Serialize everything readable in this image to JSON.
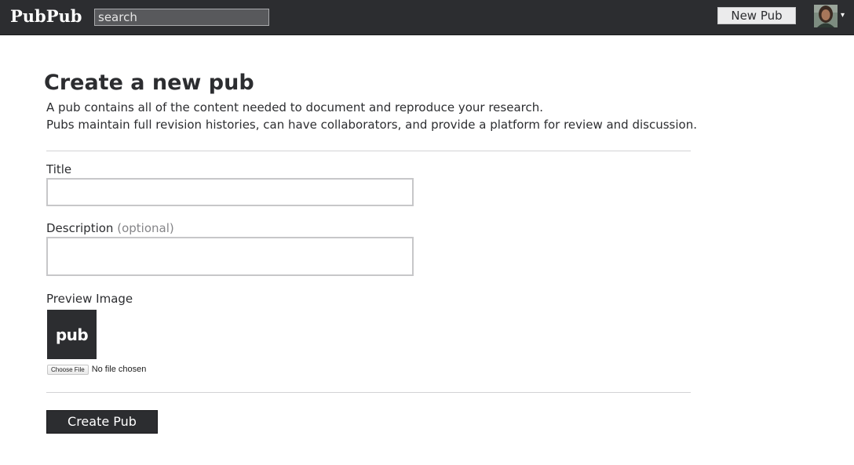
{
  "header": {
    "logo": "PubPub",
    "search_placeholder": "search",
    "new_pub_label": "New Pub",
    "menu_caret": "▾"
  },
  "main": {
    "title": "Create a new pub",
    "description_lines": [
      "A pub contains all of the content needed to document and reproduce your research.",
      "Pubs maintain full revision histories, can have collaborators, and provide a platform for review and discussion."
    ],
    "form": {
      "title_label": "Title",
      "title_value": "",
      "description_label": "Description",
      "description_optional": "(optional)",
      "description_value": "",
      "preview_label": "Preview Image",
      "preview_placeholder_text": "pub",
      "choose_file_label": "Choose File",
      "no_file_text": "No file chosen",
      "submit_label": "Create Pub"
    }
  },
  "colors": {
    "header_bg": "#2c2d30",
    "text": "#2c2d30",
    "muted": "#858588",
    "divider": "#d3d3d5"
  }
}
